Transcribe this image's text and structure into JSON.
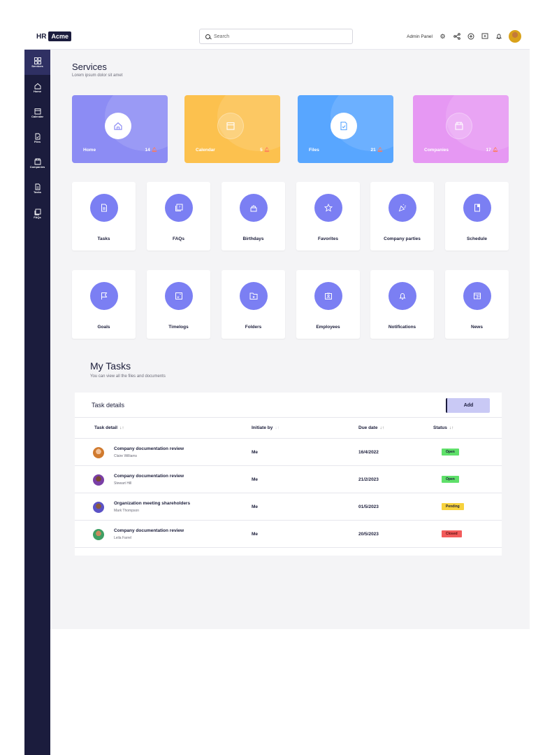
{
  "brand": {
    "prefix": "HR",
    "badge": "Acme"
  },
  "search": {
    "placeholder": "Search"
  },
  "topbar": {
    "admin_label": "Admin Panel",
    "icons": [
      "settings-icon",
      "share-icon",
      "add-icon",
      "message-icon",
      "bell-icon"
    ]
  },
  "sidebar": {
    "items": [
      {
        "label": "Services",
        "icon": "grid-icon",
        "active": true
      },
      {
        "label": "Home",
        "icon": "home-icon"
      },
      {
        "label": "Calendar",
        "icon": "calendar-icon"
      },
      {
        "label": "Files",
        "icon": "file-icon"
      },
      {
        "label": "Companies",
        "icon": "store-icon"
      },
      {
        "label": "Tasks",
        "icon": "task-icon"
      },
      {
        "label": "FAQs",
        "icon": "faq-icon"
      }
    ]
  },
  "services": {
    "title": "Services",
    "subtitle": "Lorem ipsum dolor sit amet"
  },
  "cards": [
    {
      "label": "Home",
      "count": "14",
      "icon": "home-icon",
      "color": "#8c8cf4"
    },
    {
      "label": "Calendar",
      "count": "5",
      "icon": "calendar-icon",
      "color": "#fcc14e"
    },
    {
      "label": "Files",
      "count": "21",
      "icon": "file-icon",
      "color": "#58a6ff"
    },
    {
      "label": "Companies",
      "count": "17",
      "icon": "store-icon",
      "color": "#e698f3"
    }
  ],
  "tiles_row1": [
    {
      "label": "Tasks",
      "icon": "task-icon"
    },
    {
      "label": "FAQs",
      "icon": "faq-icon"
    },
    {
      "label": "Birthdays",
      "icon": "cake-icon"
    },
    {
      "label": "Favorites",
      "icon": "star-icon"
    },
    {
      "label": "Company parties",
      "icon": "party-icon"
    },
    {
      "label": "Schedule",
      "icon": "schedule-icon"
    }
  ],
  "tiles_row2": [
    {
      "label": "Goals",
      "icon": "flag-icon"
    },
    {
      "label": "Timelogs",
      "icon": "timelog-icon"
    },
    {
      "label": "Folders",
      "icon": "folder-icon"
    },
    {
      "label": "Employees",
      "icon": "badge-icon"
    },
    {
      "label": "Notifications",
      "icon": "bell-icon"
    },
    {
      "label": "News",
      "icon": "news-icon"
    }
  ],
  "tasks": {
    "title": "My Tasks",
    "subtitle": "You can view all the  files and documents",
    "panel_title": "Task details",
    "add_label": "Add",
    "columns": [
      "Task detail",
      "Initiate by",
      "Due date",
      "Status"
    ],
    "rows": [
      {
        "task": "Company documentation review",
        "person": "Claire Williams",
        "initiated": "Me",
        "due": "16/4/2022",
        "status": "Open",
        "status_color": "#5fe06a",
        "avatar_color": "#d07a2e"
      },
      {
        "task": "Company documentation review",
        "person": "Stewart Hill",
        "initiated": "Me",
        "due": "21/2/2023",
        "status": "Open",
        "status_color": "#5fe06a",
        "avatar_color": "#7a3fa6"
      },
      {
        "task": "Organization meeting shareholders",
        "person": "Mark Thompson",
        "initiated": "Me",
        "due": "01/5/2023",
        "status": "Pending",
        "status_color": "#f7d23e",
        "avatar_color": "#5b52c6"
      },
      {
        "task": "Company documentation review",
        "person": "Leila Farrel",
        "initiated": "Me",
        "due": "20/5/2023",
        "status": "Closed",
        "status_color": "#f25b5b",
        "avatar_color": "#3f9f64"
      }
    ]
  }
}
